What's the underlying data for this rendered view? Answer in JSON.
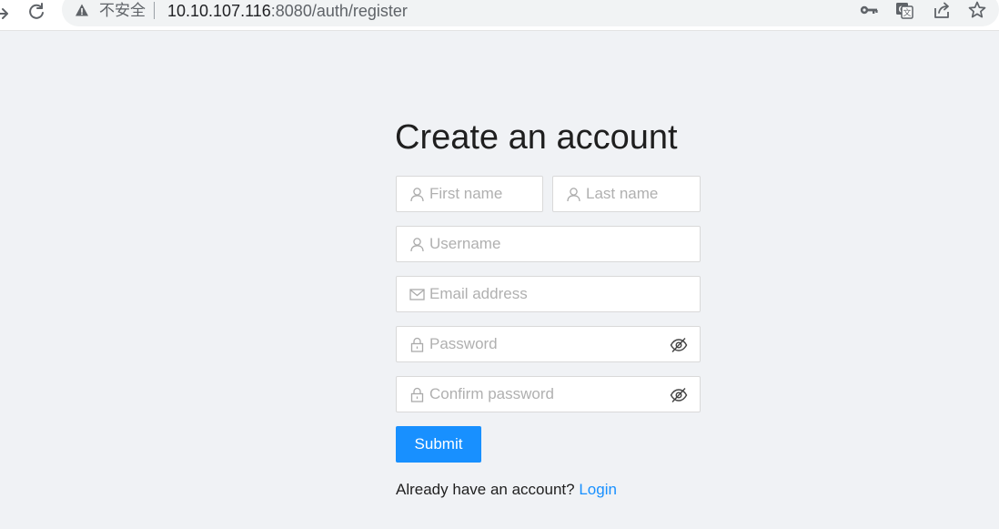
{
  "browser": {
    "insecure_label": "不安全",
    "url_host": "10.10.107.116",
    "url_rest": ":8080/auth/register",
    "icons": [
      "back-icon",
      "reload-icon",
      "warning-icon",
      "key-icon",
      "translate-icon",
      "share-icon",
      "star-icon"
    ]
  },
  "form": {
    "title": "Create an account",
    "first_name_placeholder": "First name",
    "last_name_placeholder": "Last name",
    "username_placeholder": "Username",
    "email_placeholder": "Email address",
    "password_placeholder": "Password",
    "confirm_password_placeholder": "Confirm password",
    "submit_label": "Submit",
    "login_prompt": "Already have an account?",
    "login_link": "Login"
  },
  "colors": {
    "accent": "#1890ff",
    "background": "#f0f2f5",
    "placeholder": "#b0b0b0",
    "border": "#d9d9d9"
  }
}
